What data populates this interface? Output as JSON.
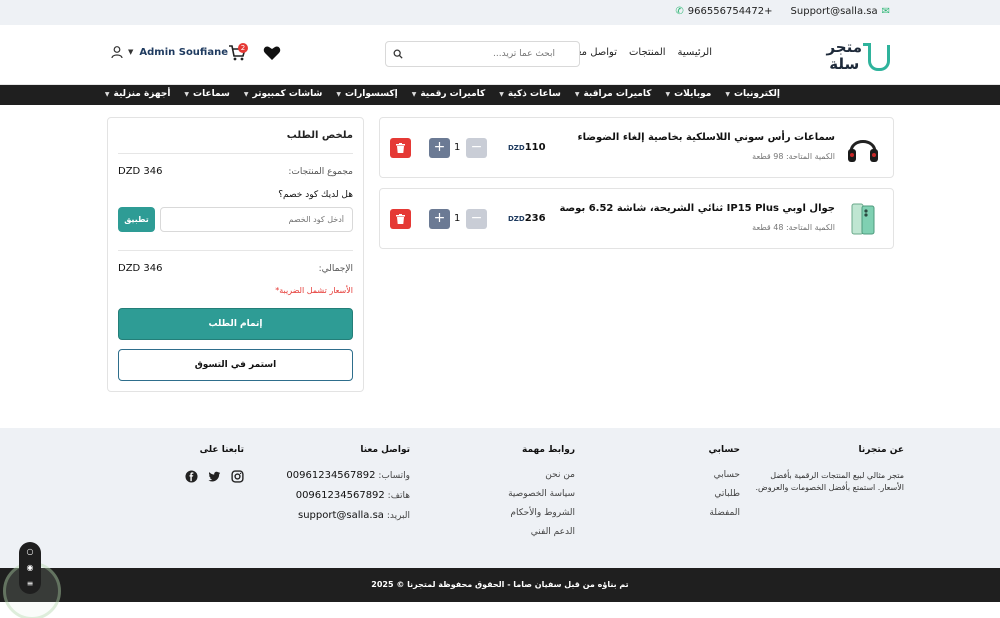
{
  "topbar": {
    "email": "Support@salla.sa",
    "phone": "966556754472+"
  },
  "header": {
    "logo_line1": "متجر",
    "logo_line2": "سلة",
    "nav": [
      "الرئيسية",
      "المنتجات",
      "تواصل معنا"
    ],
    "search_placeholder": "ابحث عما تريد...",
    "user_name": "Admin Soufiane",
    "cart_count": "2"
  },
  "categories": [
    "إلكترونيات",
    "موبايلات",
    "كاميرات مراقبة",
    "ساعات ذكية",
    "كاميرات رقمية",
    "إكسسوارات",
    "شاشات كمبيوتر",
    "سماعات",
    "أجهزة منزلية"
  ],
  "cart": {
    "items": [
      {
        "title": "سماعات رأس سوني اللاسلكية بخاصية إلغاء الضوضاء",
        "avail": "الكمية المتاحة: 98 قطعة",
        "price": "110",
        "currency": "DZD",
        "qty": "1"
      },
      {
        "title": "جوال اوبي IP15 Plus ثنائي الشريحة، شاشة 6.52 بوصة",
        "avail": "الكمية المتاحة: 48 قطعة",
        "price": "236",
        "currency": "DZD",
        "qty": "1"
      }
    ]
  },
  "summary": {
    "title": "ملخص الطلب",
    "subtotal_label": "مجموع المنتجات:",
    "subtotal_value": "DZD 346",
    "coupon_question": "هل لديك كود خصم؟",
    "coupon_placeholder": "أدخل كود الخصم",
    "apply_label": "تطبيق",
    "total_label": "الإجمالي:",
    "total_value": "DZD 346",
    "tax_note": "الأسعار تشمل الضريبة*",
    "checkout_label": "إتمام الطلب",
    "continue_label": "استمر في التسوق"
  },
  "footer": {
    "about_title": "عن متجرنا",
    "about_text": "متجر مثالي لبيع المنتجات الرقمية بأفضل الأسعار. استمتع بأفضل الخصومات والعروض.",
    "account_title": "حسابي",
    "account_links": [
      "حسابي",
      "طلباتي",
      "المفضلة"
    ],
    "links_title": "روابط مهمة",
    "links": [
      "من نحن",
      "سياسة الخصوصية",
      "الشروط والأحكام",
      "الدعم الفني"
    ],
    "contact_title": "تواصل معنا",
    "contact": [
      {
        "label": "واتساب:",
        "value": "00961234567892"
      },
      {
        "label": "هاتف:",
        "value": "00961234567892"
      },
      {
        "label": "البريد:",
        "value": "support@salla.sa"
      }
    ],
    "follow_title": "تابعنا على",
    "copyright": "تم بناؤه من قبل سفيان صاما - الحقوق محفوظة لمتجرنا © 2025"
  },
  "colors": {
    "accent": "#2e9c95",
    "danger": "#e53935",
    "dark": "#1f1f1f",
    "footer_bg": "#eef1f5"
  }
}
